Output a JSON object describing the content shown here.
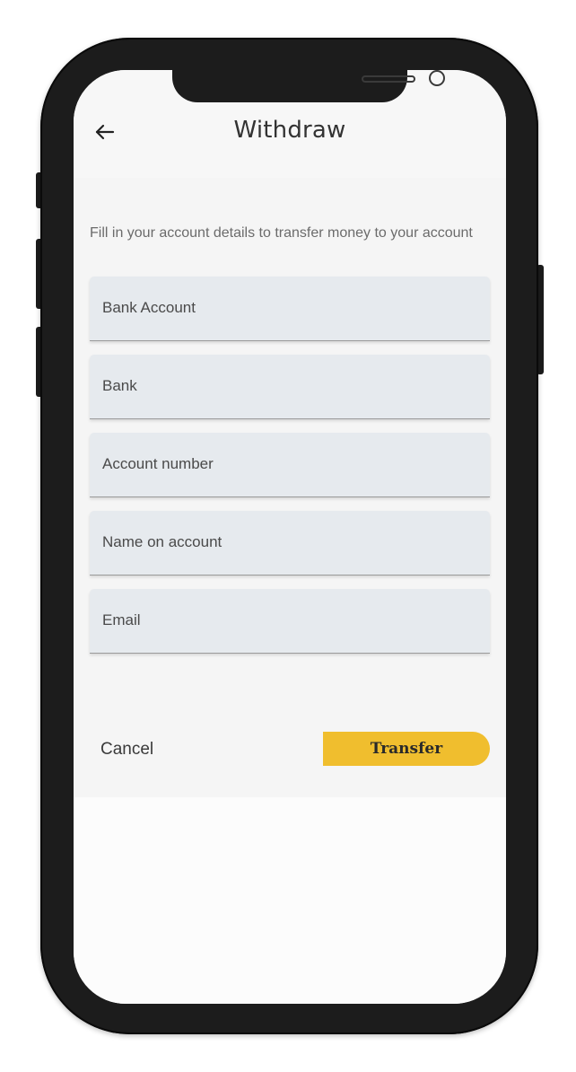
{
  "header": {
    "title": "Withdraw",
    "back_icon": "arrow-left-icon"
  },
  "form": {
    "instructions": "Fill in your account details to transfer money to your account",
    "fields": [
      {
        "placeholder": "Bank Account",
        "value": ""
      },
      {
        "placeholder": "Bank",
        "value": ""
      },
      {
        "placeholder": "Account number",
        "value": ""
      },
      {
        "placeholder": "Name on account",
        "value": ""
      },
      {
        "placeholder": "Email",
        "value": ""
      }
    ]
  },
  "actions": {
    "cancel_label": "Cancel",
    "transfer_label": "Transfer"
  },
  "colors": {
    "accent": "#f0be2e",
    "field_bg": "#e6eaee",
    "phone_frame": "#1c1c1c"
  }
}
